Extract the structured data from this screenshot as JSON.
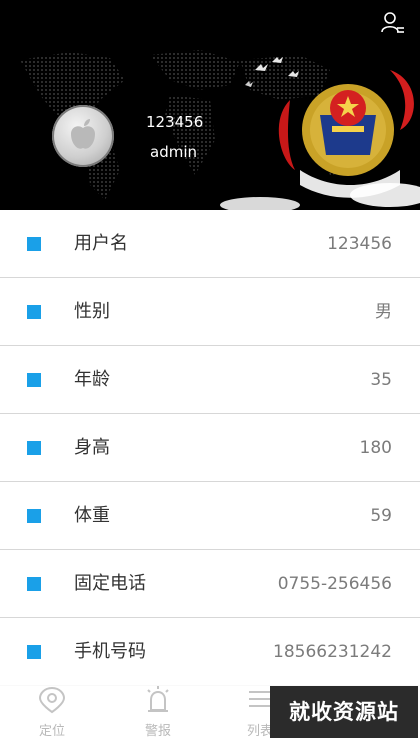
{
  "header": {
    "account": "123456",
    "user_name": "admin"
  },
  "profile": {
    "rows": [
      {
        "label": "用户名",
        "value": "123456"
      },
      {
        "label": "性别",
        "value": "男"
      },
      {
        "label": "年龄",
        "value": "35"
      },
      {
        "label": "身高",
        "value": "180"
      },
      {
        "label": "体重",
        "value": "59"
      },
      {
        "label": "固定电话",
        "value": "0755-256456"
      },
      {
        "label": "手机号码",
        "value": "18566231242"
      }
    ]
  },
  "tabbar": {
    "locate": "定位",
    "alarm": "警报",
    "list": "列表"
  },
  "watermark": "就收资源站",
  "colors": {
    "accent": "#1aa0e8",
    "header_bg": "#000000",
    "divider": "#d7d7d7",
    "value_text": "#7b7b7b"
  },
  "icons": {
    "user_button": "user-profile-icon",
    "avatar": "apple-logo-icon",
    "locate": "location-pin-icon",
    "alarm": "alarm-light-icon",
    "list": "list-icon",
    "emblem": "police-emblem-icon"
  }
}
